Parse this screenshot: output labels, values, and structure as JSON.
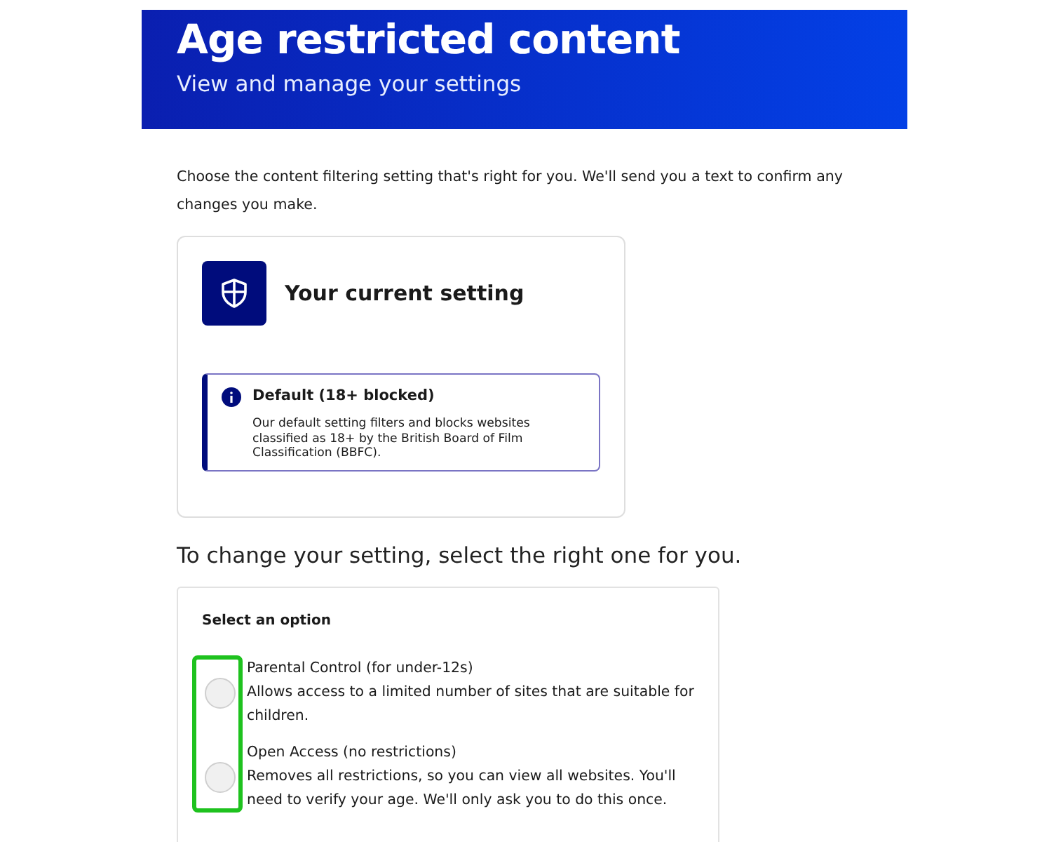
{
  "header": {
    "title": "Age restricted content",
    "subtitle": "View and manage your settings"
  },
  "intro": "Choose the content filtering setting that's right for you. We'll send you a text to confirm any changes you make.",
  "current": {
    "title": "Your current setting",
    "notice": {
      "title": "Default (18+ blocked)",
      "text": "Our default setting filters and blocks websites classified as 18+ by the British Board of Film Classification (BBFC)."
    }
  },
  "change_heading": "To change your setting, select the right one for you.",
  "options_panel": {
    "legend": "Select an option",
    "highlighted": true,
    "options": [
      {
        "label": "Parental Control (for under-12s)",
        "description": "Allows access to a limited number of sites that are suitable for children.",
        "selected": false
      },
      {
        "label": "Open Access (no restrictions)",
        "description": "Removes all restrictions, so you can view all websites. You'll need to verify your age. We'll only ask you to do this once.",
        "selected": false
      }
    ]
  }
}
